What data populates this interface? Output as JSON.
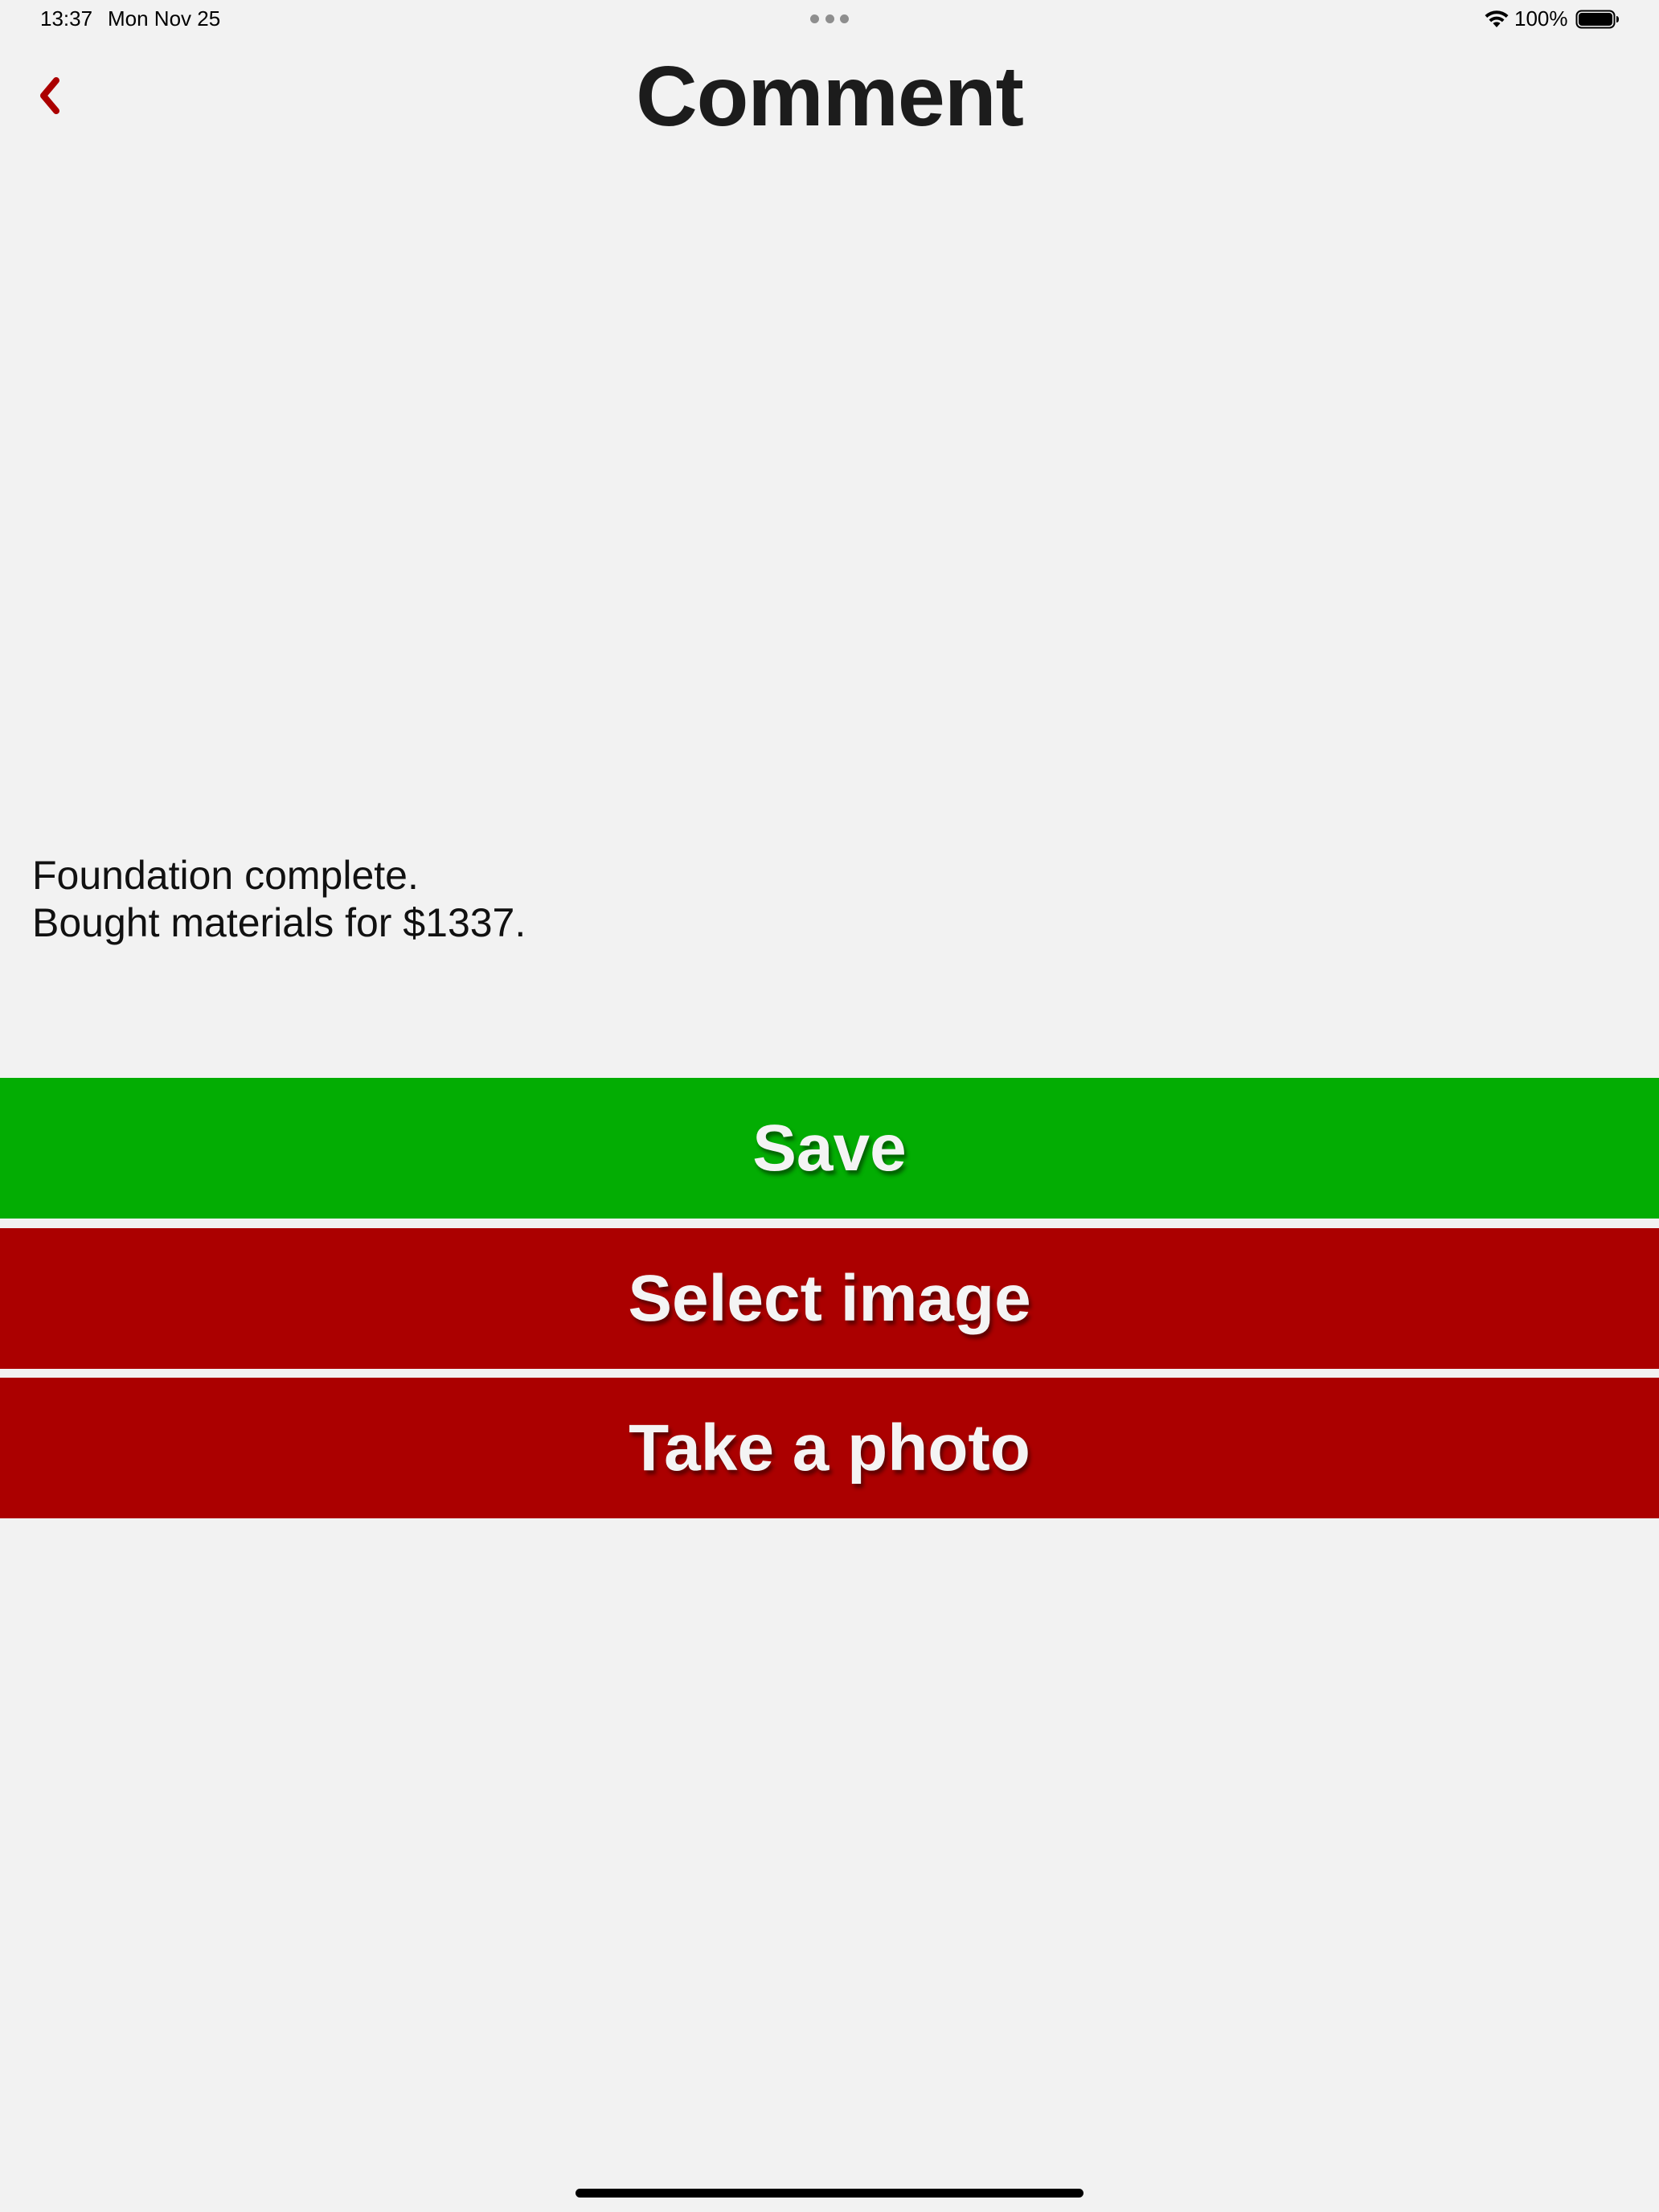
{
  "status_bar": {
    "time": "13:37",
    "date": "Mon Nov 25",
    "battery_percent": "100%",
    "battery_level": 1.0,
    "icons": [
      "wifi-icon",
      "battery-icon",
      "multitask-dots-icon"
    ]
  },
  "header": {
    "title": "Comment",
    "back_icon": "chevron-left-icon"
  },
  "comment": {
    "text": "Foundation complete.\nBought materials for $1337."
  },
  "actions": {
    "save_label": "Save",
    "select_image_label": "Select image",
    "take_photo_label": "Take a photo"
  },
  "colors": {
    "accent": "#ab0000",
    "save_green": "#03ad03",
    "background": "#f2f2f2"
  }
}
